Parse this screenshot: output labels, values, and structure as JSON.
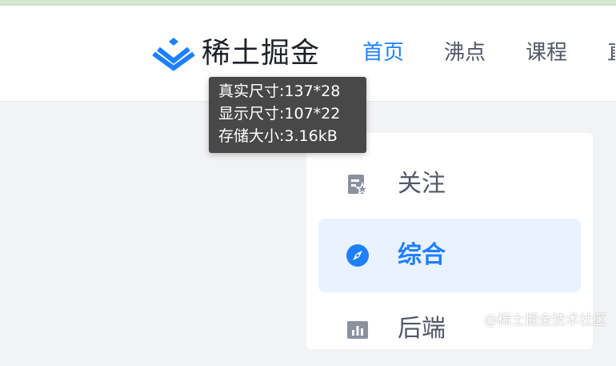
{
  "header": {
    "logo_text": "稀土掘金",
    "nav": [
      {
        "label": "首页",
        "active": true
      },
      {
        "label": "沸点",
        "active": false
      },
      {
        "label": "课程",
        "active": false
      },
      {
        "label": "直",
        "active": false
      }
    ]
  },
  "tooltip": {
    "lines": [
      "真实尺寸:137*28",
      "显示尺寸:107*22",
      "存储大小:3.16kB"
    ]
  },
  "sidebar": {
    "items": [
      {
        "label": "关注",
        "icon": "follow-icon",
        "active": false
      },
      {
        "label": "综合",
        "icon": "compass-icon",
        "active": true
      },
      {
        "label": "后端",
        "icon": "bar-chart-icon",
        "active": false
      }
    ]
  },
  "watermark": "@稀土掘金技术社区",
  "colors": {
    "brand": "#1e80ff",
    "text": "#515767",
    "background": "#f2f3f5",
    "active_bg": "#eaf2ff"
  }
}
